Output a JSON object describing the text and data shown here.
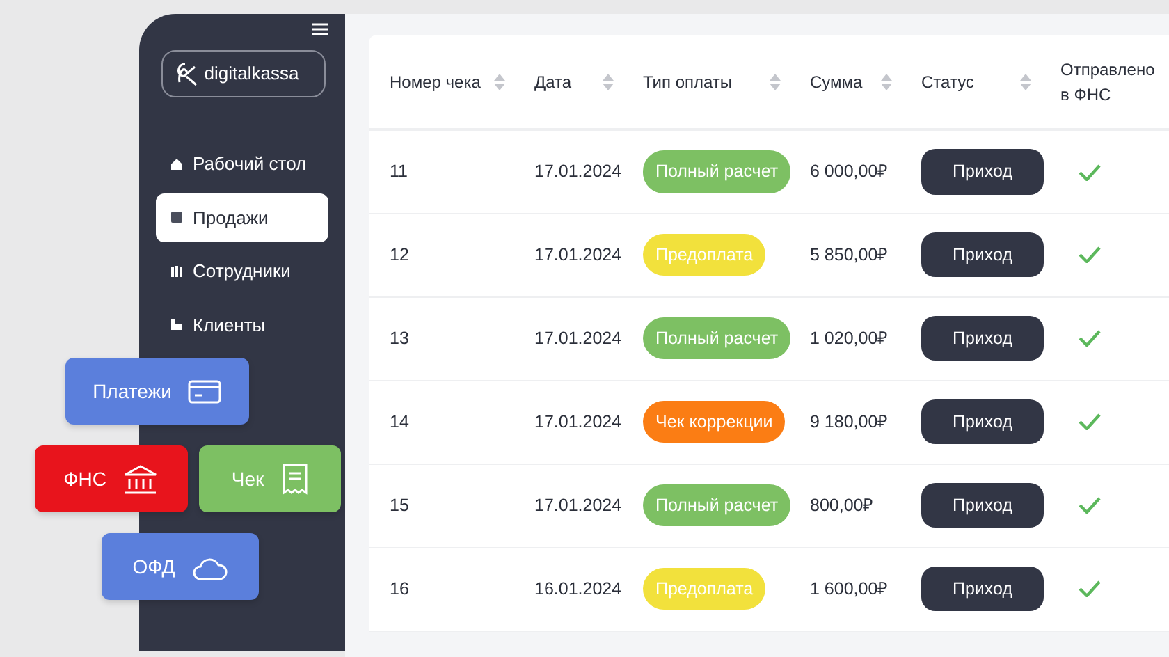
{
  "sidebar": {
    "logo": "digitalkassa",
    "items": [
      {
        "label": "Рабочий стол",
        "selected": false
      },
      {
        "label": "Продажи",
        "selected": true
      },
      {
        "label": "Сотрудники",
        "selected": false
      },
      {
        "label": "Клиенты",
        "selected": false
      }
    ]
  },
  "tiles": [
    {
      "label": "Платежи",
      "color": "#5b7fdc"
    },
    {
      "label": "ФНС",
      "color": "#e8141c"
    },
    {
      "label": "Чек",
      "color": "#7dc063"
    },
    {
      "label": "ОФД",
      "color": "#5b7fdc"
    }
  ],
  "table": {
    "columns": [
      {
        "label": "Номер чека",
        "sortable": true
      },
      {
        "label": "Дата",
        "sortable": true
      },
      {
        "label": "Тип оплаты",
        "sortable": true
      },
      {
        "label": "Сумма",
        "sortable": true
      },
      {
        "label": "Статус",
        "sortable": true
      },
      {
        "label": "Отправлено в ФНС",
        "sortable": false
      }
    ],
    "rows": [
      {
        "number": "11",
        "date": "17.01.2024",
        "payment": {
          "label": "Полный расчет",
          "color": "#7dc063"
        },
        "sum": "6 000,00₽",
        "status": "Приход",
        "sent": true
      },
      {
        "number": "12",
        "date": "17.01.2024",
        "payment": {
          "label": "Предоплата",
          "color": "#f2e13c"
        },
        "sum": "5 850,00₽",
        "status": "Приход",
        "sent": true
      },
      {
        "number": "13",
        "date": "17.01.2024",
        "payment": {
          "label": "Полный расчет",
          "color": "#7dc063"
        },
        "sum": "1 020,00₽",
        "status": "Приход",
        "sent": true
      },
      {
        "number": "14",
        "date": "17.01.2024",
        "payment": {
          "label": "Чек коррекции",
          "color": "#fb7d14"
        },
        "sum": "9 180,00₽",
        "status": "Приход",
        "sent": true
      },
      {
        "number": "15",
        "date": "17.01.2024",
        "payment": {
          "label": "Полный расчет",
          "color": "#7dc063"
        },
        "sum": "800,00₽",
        "status": "Приход",
        "sent": true
      },
      {
        "number": "16",
        "date": "16.01.2024",
        "payment": {
          "label": "Предоплата",
          "color": "#f2e13c"
        },
        "sum": "1 600,00₽",
        "status": "Приход",
        "sent": true
      }
    ]
  }
}
